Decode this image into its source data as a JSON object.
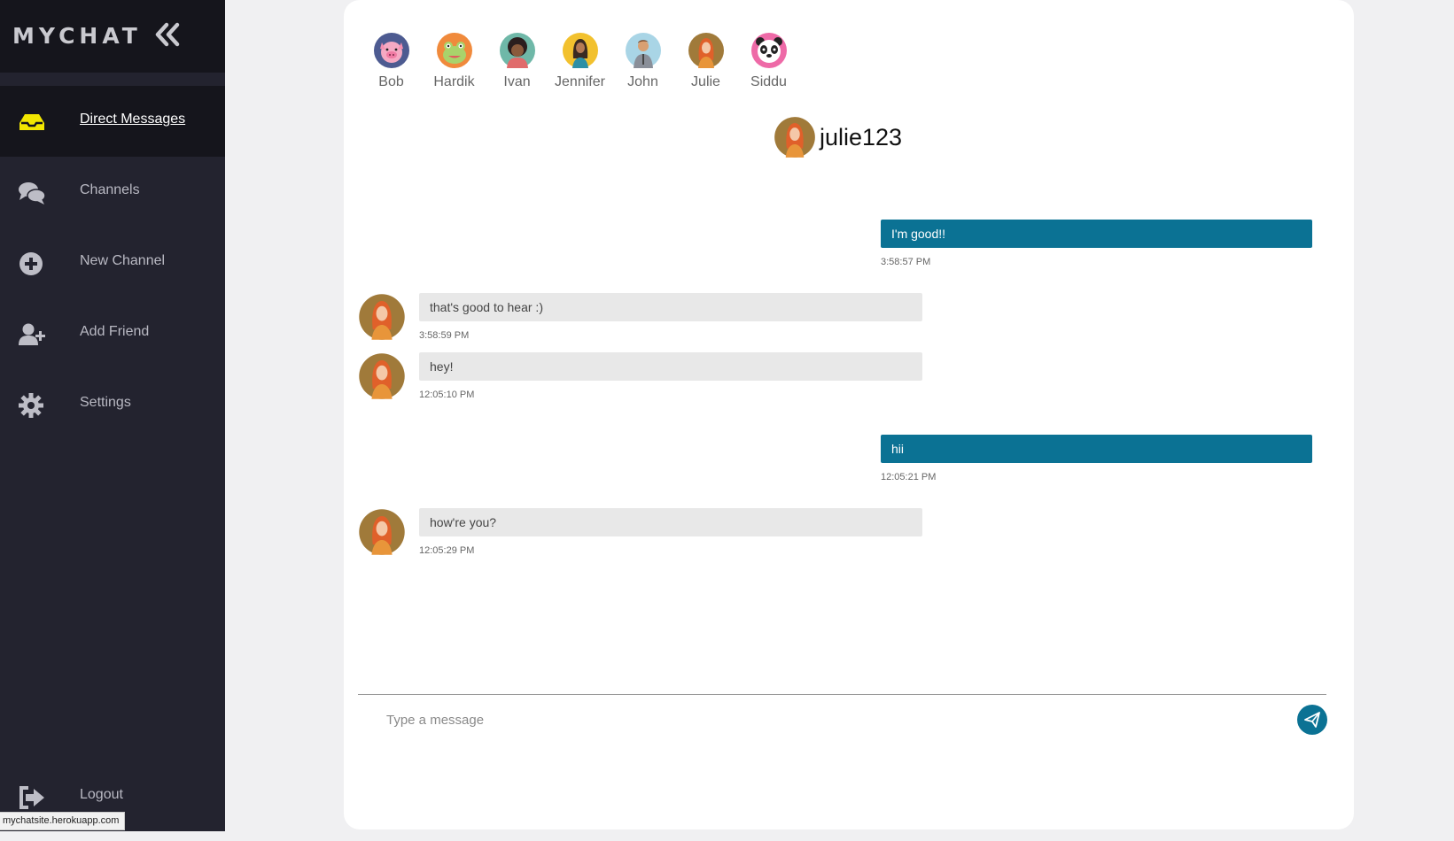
{
  "app": {
    "brand": "MYCHAT"
  },
  "sidebar": {
    "items": [
      {
        "label": "Direct Messages",
        "icon": "inbox-icon",
        "active": true
      },
      {
        "label": "Channels",
        "icon": "comments-icon",
        "active": false
      },
      {
        "label": "New Channel",
        "icon": "plus-circle-icon",
        "active": false
      },
      {
        "label": "Add Friend",
        "icon": "user-plus-icon",
        "active": false
      },
      {
        "label": "Settings",
        "icon": "gear-icon",
        "active": false
      }
    ],
    "logout_label": "Logout"
  },
  "status_bar": {
    "url": "mychatsite.herokuapp.com"
  },
  "friends": [
    {
      "name": "Bob",
      "avatar": "pig-avatar"
    },
    {
      "name": "Hardik",
      "avatar": "frog-avatar"
    },
    {
      "name": "Ivan",
      "avatar": "person-avatar"
    },
    {
      "name": "Jennifer",
      "avatar": "woman-avatar"
    },
    {
      "name": "John",
      "avatar": "man-avatar"
    },
    {
      "name": "Julie",
      "avatar": "woman-redhair-avatar"
    },
    {
      "name": "Siddu",
      "avatar": "panda-avatar"
    }
  ],
  "chat": {
    "title": "julie123",
    "messages": [
      {
        "direction": "out",
        "text": "I'm good!!",
        "time": "3:58:57 PM"
      },
      {
        "direction": "in",
        "text": "that's good to hear :)",
        "time": "3:58:59 PM"
      },
      {
        "direction": "in",
        "text": "hey!",
        "time": "12:05:10 PM"
      },
      {
        "direction": "out",
        "text": "hii",
        "time": "12:05:21 PM"
      },
      {
        "direction": "in",
        "text": "how're you?",
        "time": "12:05:29 PM"
      }
    ],
    "composer_placeholder": "Type a message",
    "composer_value": ""
  },
  "colors": {
    "accent": "#0b7294",
    "sidebar": "#23232f",
    "sidebar_active": "#15151c",
    "inbox_icon": "#f2e600"
  }
}
